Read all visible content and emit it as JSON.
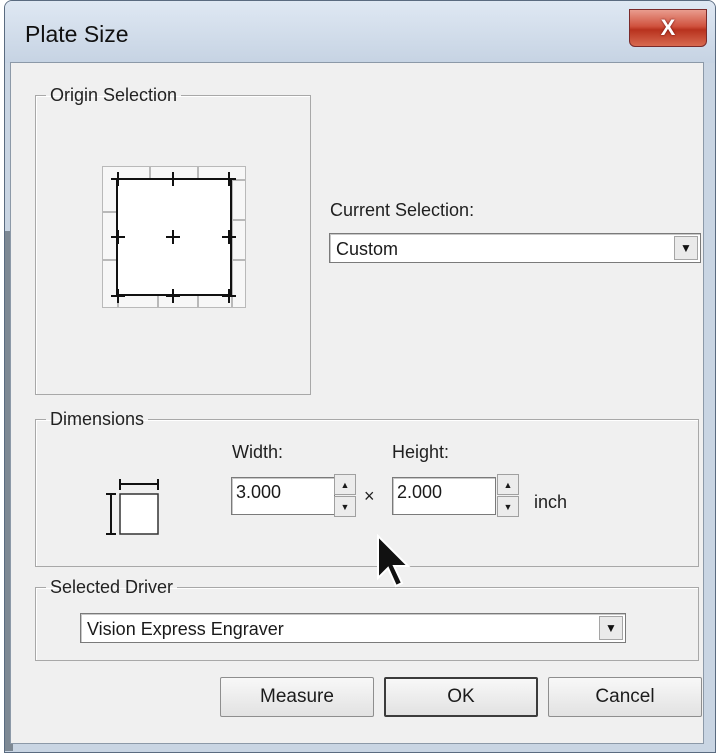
{
  "window": {
    "title": "Plate Size",
    "close_glyph": "X"
  },
  "origin": {
    "legend": "Origin Selection",
    "current_label": "Current Selection:",
    "current_value": "Custom"
  },
  "dimensions": {
    "legend": "Dimensions",
    "width_label": "Width:",
    "width_value": "3.000",
    "height_label": "Height:",
    "height_value": "2.000",
    "times": "×",
    "unit": "inch"
  },
  "driver": {
    "legend": "Selected Driver",
    "value": "Vision Express Engraver"
  },
  "buttons": {
    "measure": "Measure",
    "ok": "OK",
    "cancel": "Cancel"
  },
  "icons": {
    "dropdown": "▼",
    "spin_up": "▲",
    "spin_down": "▼"
  }
}
